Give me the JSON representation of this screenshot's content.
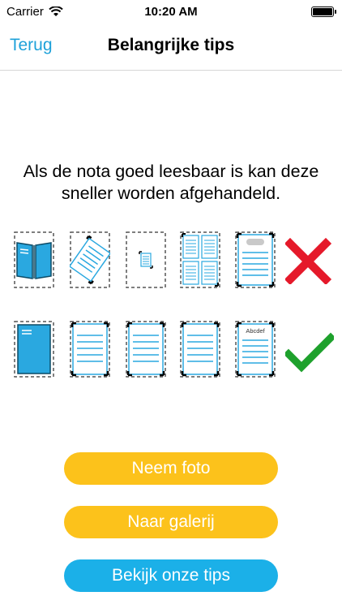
{
  "status_bar": {
    "carrier": "Carrier",
    "time": "10:20 AM"
  },
  "nav": {
    "back_label": "Terug",
    "title": "Belangrijke tips"
  },
  "info": {
    "text": "Als de nota goed leesbaar is kan deze sneller worden afgehandeld."
  },
  "examples": {
    "bad": [
      {
        "icon": "open-booklet-icon"
      },
      {
        "icon": "rotated-document-icon"
      },
      {
        "icon": "too-small-document-icon"
      },
      {
        "icon": "multiple-documents-icon"
      },
      {
        "icon": "blurred-document-icon"
      }
    ],
    "good": [
      {
        "icon": "closed-booklet-icon"
      },
      {
        "icon": "document-icon"
      },
      {
        "icon": "document-icon"
      },
      {
        "icon": "document-icon"
      },
      {
        "icon": "readable-document-icon",
        "label": "Abcdef"
      }
    ],
    "bad_icon": "cross-icon",
    "good_icon": "checkmark-icon"
  },
  "colors": {
    "accent_blue": "#1ea1d9",
    "button_yellow": "#fcc21b",
    "button_blue": "#1bb0e8",
    "cross_red": "#e5192a",
    "check_green": "#1ea12c"
  },
  "buttons": {
    "photo": "Neem foto",
    "gallery": "Naar galerij",
    "tips": "Bekijk onze tips"
  }
}
